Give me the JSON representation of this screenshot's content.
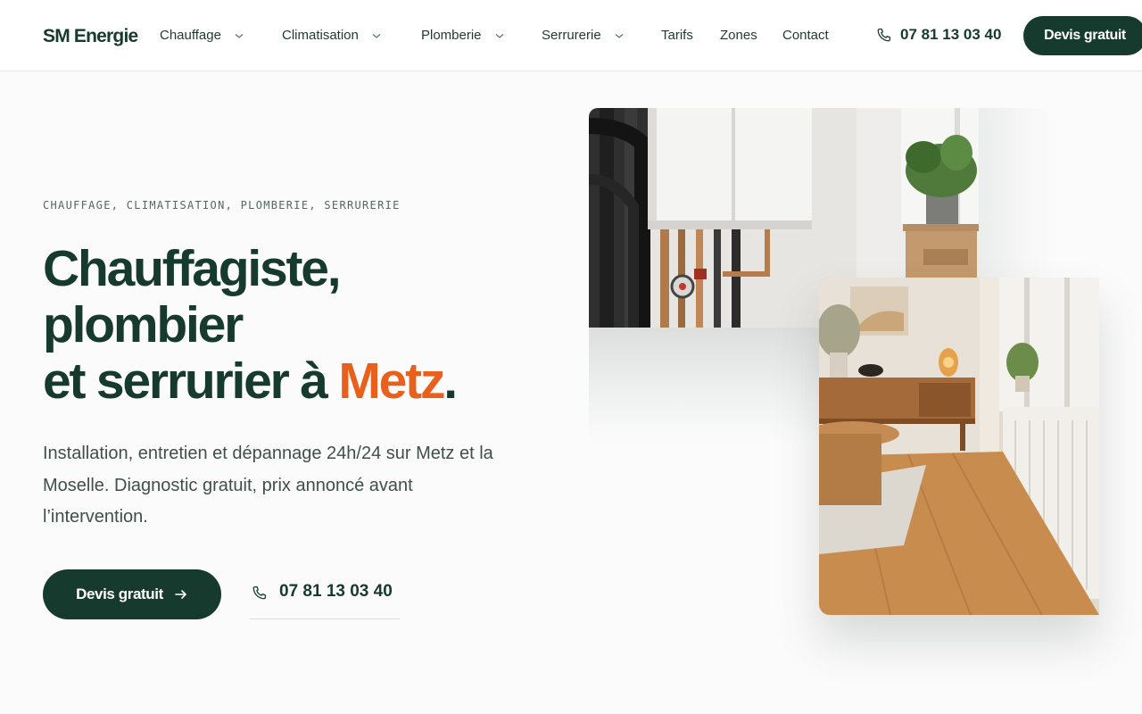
{
  "brand": {
    "name": "SM Energie"
  },
  "nav": {
    "items": [
      {
        "label": "Chauffage",
        "has_dropdown": true
      },
      {
        "label": "Climatisation",
        "has_dropdown": true
      },
      {
        "label": "Plomberie",
        "has_dropdown": true
      },
      {
        "label": "Serrurerie",
        "has_dropdown": true
      },
      {
        "label": "Tarifs",
        "has_dropdown": false
      },
      {
        "label": "Zones",
        "has_dropdown": false
      },
      {
        "label": "Contact",
        "has_dropdown": false
      }
    ],
    "phone": "07 81 13 03 40",
    "phone_icon": "phone-icon",
    "cta_label": "Devis gratuit"
  },
  "hero": {
    "eyebrow": "CHAUFFAGE, CLIMATISATION, PLOMBERIE, SERRURERIE",
    "headline_line1": "Chauffagiste,",
    "headline_line2": "plombier",
    "headline_line3_prefix": "et serrurier à ",
    "headline_accent": "Metz",
    "headline_suffix": ".",
    "lede": "Installation, entretien et dépannage 24h/24 sur Metz et la Moselle. Diagnostic gratuit, prix annoncé avant l’intervention.",
    "cta_primary_label": "Devis gratuit",
    "cta_primary_icon": "arrow-right-icon",
    "cta_phone": "07 81 13 03 40",
    "cta_phone_icon": "phone-icon"
  },
  "colors": {
    "primary": "#163a2e",
    "accent": "#e8601c",
    "background": "#fbfbfb",
    "header_bg": "#ffffff",
    "body_text": "#3f4f49"
  },
  "images": [
    {
      "name": "boiler-photo",
      "subject": "wall-mounted boiler with pipes and potted plant"
    },
    {
      "name": "living-room-photo",
      "subject": "living room with wooden floor, radiator and sideboard"
    }
  ]
}
